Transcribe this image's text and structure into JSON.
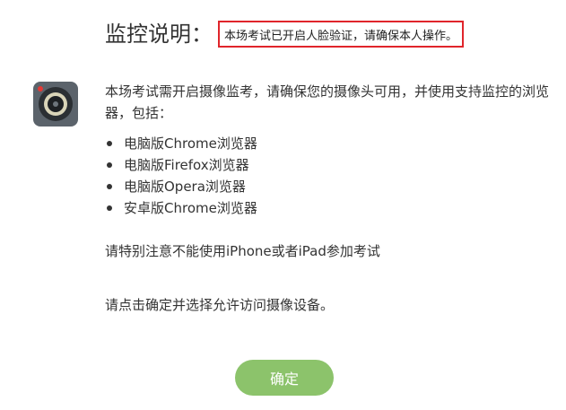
{
  "header": {
    "title": "监控说明：",
    "notice": "本场考试已开启人脸验证，请确保本人操作。"
  },
  "icon": {
    "name": "camera-icon",
    "colors": {
      "body": "#5b636b",
      "lens": "#2b2f33",
      "ring": "#d9d4b8",
      "record": "#e53935"
    }
  },
  "content": {
    "intro": "本场考试需开启摄像监考，请确保您的摄像头可用，并使用支持监控的浏览器，包括：",
    "browsers": [
      "电脑版Chrome浏览器",
      "电脑版Firefox浏览器",
      "电脑版Opera浏览器",
      "安卓版Chrome浏览器"
    ],
    "warning": "请特别注意不能使用iPhone或者iPad参加考试",
    "instruction": "请点击确定并选择允许访问摄像设备。"
  },
  "actions": {
    "confirm_label": "确定"
  },
  "colors": {
    "accent": "#8cc36b",
    "notice_border": "#e0252b",
    "text": "#333333"
  }
}
